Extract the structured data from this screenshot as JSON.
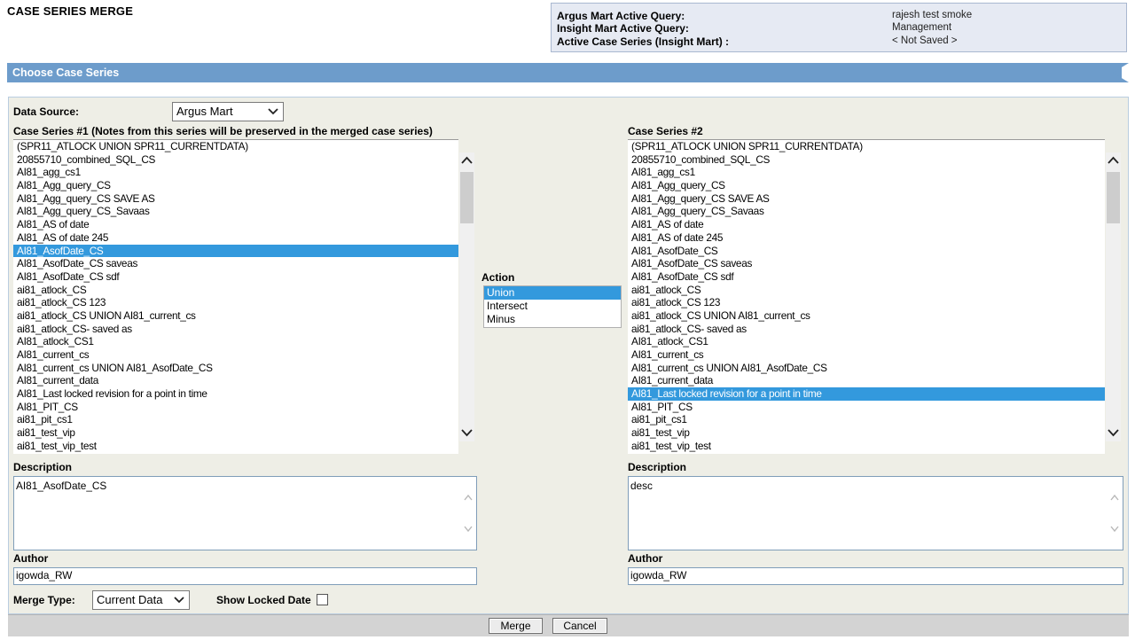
{
  "page": {
    "title": "CASE SERIES MERGE"
  },
  "info": {
    "rows": [
      {
        "label": "Argus Mart Active Query:",
        "value": "rajesh test smoke"
      },
      {
        "label": "Insight Mart Active Query:",
        "value": "Management"
      },
      {
        "label": "Active Case Series (Insight Mart) :",
        "value": "< Not Saved >"
      }
    ]
  },
  "section": {
    "title": "Choose Case Series"
  },
  "form": {
    "data_source_label": "Data Source:",
    "data_source_value": "Argus Mart",
    "series1_label": "Case Series #1 (Notes from this series will be preserved in the merged case series)",
    "series2_label": "Case Series #2",
    "action_label": "Action",
    "actions": [
      "Union",
      "Intersect",
      "Minus"
    ],
    "selected_action": "Union",
    "series1_items": [
      "(SPR11_ATLOCK UNION SPR11_CURRENTDATA)",
      "20855710_combined_SQL_CS",
      "AI81_agg_cs1",
      "AI81_Agg_query_CS",
      "AI81_Agg_query_CS SAVE AS",
      "AI81_Agg_query_CS_Savaas",
      "AI81_AS of date",
      "AI81_AS of date 245",
      "AI81_AsofDate_CS",
      "AI81_AsofDate_CS saveas",
      "AI81_AsofDate_CS sdf",
      "ai81_atlock_CS",
      "ai81_atlock_CS 123",
      "ai81_atlock_CS UNION AI81_current_cs",
      "ai81_atlock_CS- saved as",
      "AI81_atlock_CS1",
      "AI81_current_cs",
      "AI81_current_cs UNION AI81_AsofDate_CS",
      "AI81_current_data",
      "AI81_Last locked revision for a point in time",
      "AI81_PIT_CS",
      "ai81_pit_cs1",
      "ai81_test_vip",
      "ai81_test_vip_test"
    ],
    "series1_selected_index": 8,
    "series2_items": [
      "(SPR11_ATLOCK UNION SPR11_CURRENTDATA)",
      "20855710_combined_SQL_CS",
      "AI81_agg_cs1",
      "AI81_Agg_query_CS",
      "AI81_Agg_query_CS SAVE AS",
      "AI81_Agg_query_CS_Savaas",
      "AI81_AS of date",
      "AI81_AS of date 245",
      "AI81_AsofDate_CS",
      "AI81_AsofDate_CS saveas",
      "AI81_AsofDate_CS sdf",
      "ai81_atlock_CS",
      "ai81_atlock_CS 123",
      "ai81_atlock_CS UNION AI81_current_cs",
      "ai81_atlock_CS- saved as",
      "AI81_atlock_CS1",
      "AI81_current_cs",
      "AI81_current_cs UNION AI81_AsofDate_CS",
      "AI81_current_data",
      "AI81_Last locked revision for a point in time",
      "AI81_PIT_CS",
      "ai81_pit_cs1",
      "ai81_test_vip",
      "ai81_test_vip_test"
    ],
    "series2_selected_index": 19,
    "description_label": "Description",
    "description1_value": "AI81_AsofDate_CS",
    "description2_value": "desc",
    "author_label": "Author",
    "author1_value": "igowda_RW",
    "author2_value": "igowda_RW",
    "merge_type_label": "Merge Type:",
    "merge_type_value": "Current Data",
    "show_locked_label": "Show Locked Date",
    "show_locked_checked": false
  },
  "buttons": {
    "merge": "Merge",
    "cancel": "Cancel"
  },
  "colors": {
    "section_bar": "#6d9ccb",
    "selection": "#3399dd",
    "panel_bg": "#eeeee6"
  }
}
